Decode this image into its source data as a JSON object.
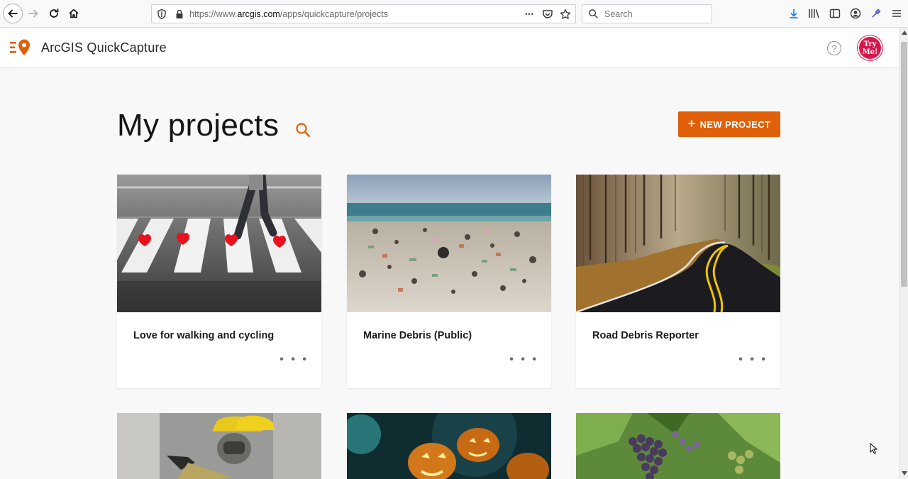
{
  "browser": {
    "url_prefix": "https://www.",
    "url_domain": "arcgis.com",
    "url_path": "/apps/quickcapture/projects",
    "search_placeholder": "Search",
    "more_glyph": "•••"
  },
  "app": {
    "title": "ArcGIS QuickCapture",
    "help_label": "?",
    "avatar_line1": "Try",
    "avatar_line2": "Me!"
  },
  "main": {
    "page_title": "My projects",
    "new_project_label": "NEW PROJECT",
    "plus": "+",
    "more_label": "• • •",
    "projects": [
      {
        "name": "Love for walking and cycling"
      },
      {
        "name": "Marine Debris (Public)"
      },
      {
        "name": "Road Debris Reporter"
      }
    ]
  },
  "colors": {
    "accent": "#e0600a",
    "avatar": "#d9174b"
  }
}
